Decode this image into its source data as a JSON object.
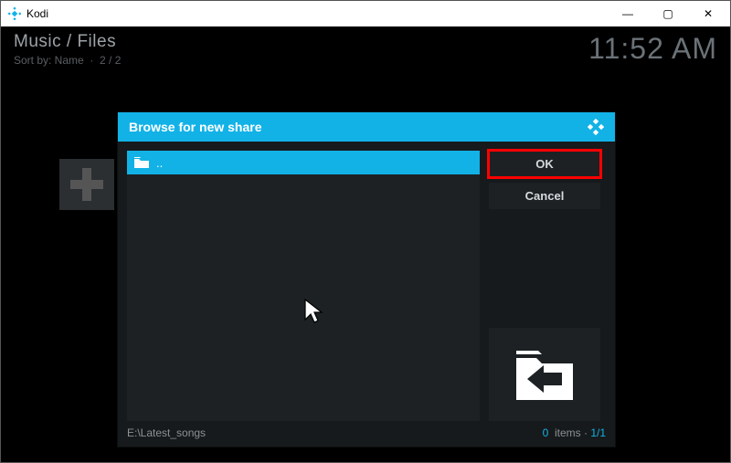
{
  "window": {
    "title": "Kodi"
  },
  "header": {
    "breadcrumb": "Music / Files",
    "sort_label": "Sort by: Name",
    "page_info": "2 / 2",
    "clock": "11:52 AM"
  },
  "dialog": {
    "title": "Browse for new share",
    "list": {
      "up_label": ".."
    },
    "buttons": {
      "ok": "OK",
      "cancel": "Cancel"
    },
    "status": {
      "path": "E:\\Latest_songs",
      "items_count": "0",
      "items_word": "items",
      "page": "1/1"
    }
  },
  "win_controls": {
    "min": "—",
    "max": "▢",
    "close": "✕"
  }
}
